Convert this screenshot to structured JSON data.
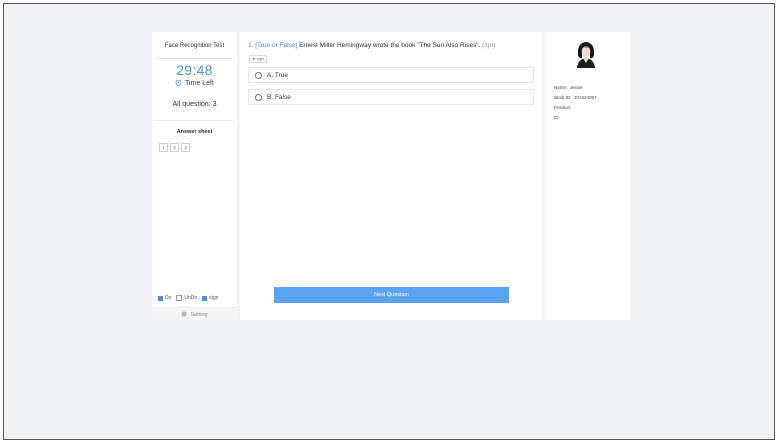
{
  "left_panel": {
    "test_title": "Face Recognition Test",
    "timer": "29:48",
    "time_left_label": "Time Left",
    "all_question": "All question: 3",
    "answer_sheet_title": "Answer sheet",
    "answer_boxes": [
      "1",
      "2",
      "3"
    ],
    "legend": {
      "do": "Do",
      "undo": "UnDo",
      "sign": "sign"
    },
    "setting_label": "Setting"
  },
  "question": {
    "prefix": "1. [True or False]",
    "text": "Ernest Miller Hemingway wrote the book \"The Sun Also Rises\".",
    "points": "(1pt)",
    "sign_tag": "sign",
    "options": [
      "A. True",
      "B. False"
    ]
  },
  "next_button_label": "Next Question",
  "profile": {
    "name_label": "Name:",
    "name_value": "Jessie",
    "work_id_label": "Work ID:",
    "work_id_value": "201624097",
    "position_label": "Position:",
    "position_value": "",
    "id_label": "ID:",
    "id_value": ""
  },
  "colors": {
    "accent": "#4a90e2",
    "button": "#5aa2f3",
    "background": "#f1f2f6"
  },
  "icons": [
    "alarm-clock-icon",
    "gear-icon",
    "star-icon",
    "user-avatar"
  ]
}
